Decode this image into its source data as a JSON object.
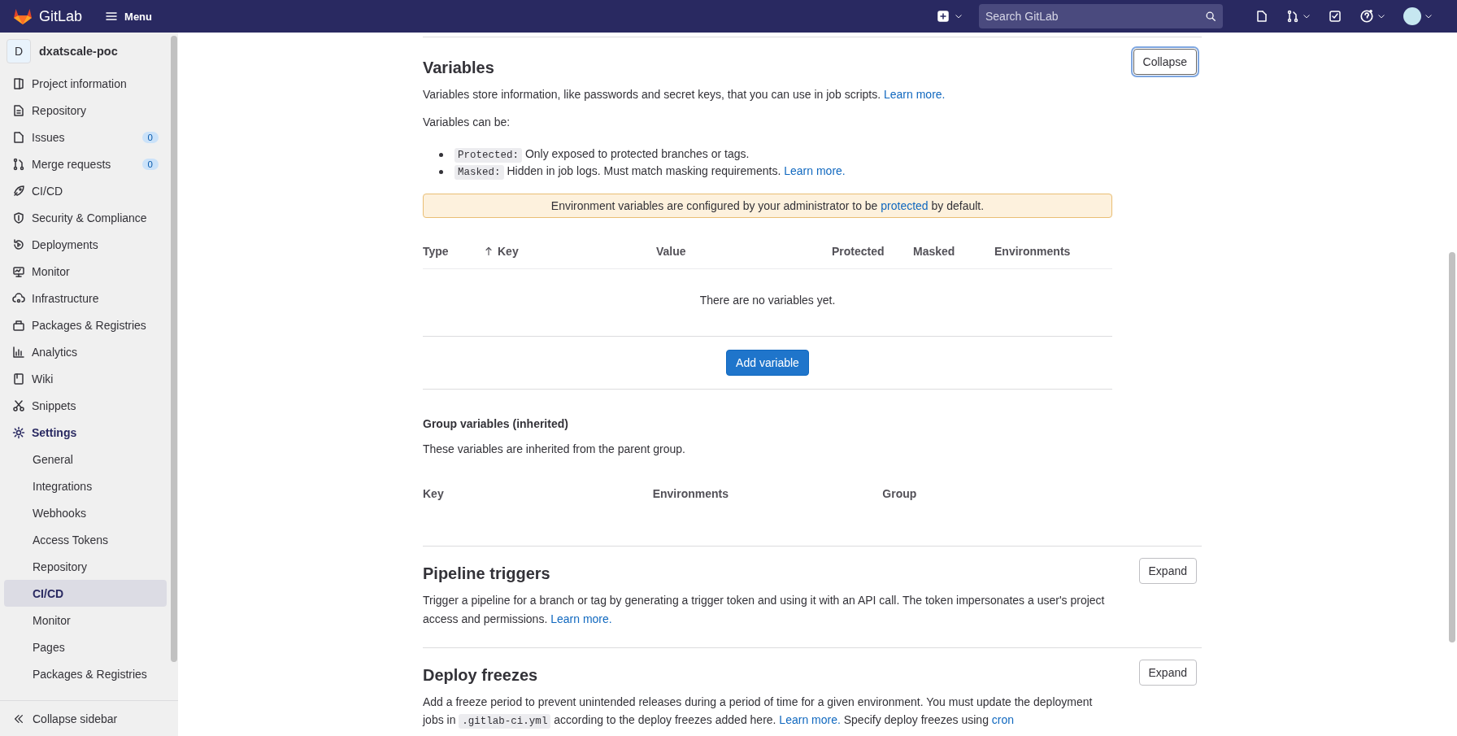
{
  "topbar": {
    "brand": "GitLab",
    "menu": "Menu",
    "search": {
      "placeholder": "Search GitLab"
    }
  },
  "sidebar": {
    "project": {
      "initial": "D",
      "name": "dxatscale-poc"
    },
    "items": [
      {
        "label": "Project information",
        "selected": false
      },
      {
        "label": "Repository",
        "selected": false
      },
      {
        "label": "Issues",
        "badge": "0",
        "selected": false
      },
      {
        "label": "Merge requests",
        "badge": "0",
        "selected": false
      },
      {
        "label": "CI/CD",
        "selected": false
      },
      {
        "label": "Security & Compliance",
        "selected": false
      },
      {
        "label": "Deployments",
        "selected": false
      },
      {
        "label": "Monitor",
        "selected": false
      },
      {
        "label": "Infrastructure",
        "selected": false
      },
      {
        "label": "Packages & Registries",
        "selected": false
      },
      {
        "label": "Analytics",
        "selected": false
      },
      {
        "label": "Wiki",
        "selected": false
      },
      {
        "label": "Snippets",
        "selected": false
      },
      {
        "label": "Settings",
        "selected": true,
        "expanded": true,
        "children": [
          {
            "label": "General",
            "selected": false
          },
          {
            "label": "Integrations",
            "selected": false
          },
          {
            "label": "Webhooks",
            "selected": false
          },
          {
            "label": "Access Tokens",
            "selected": false
          },
          {
            "label": "Repository",
            "selected": false
          },
          {
            "label": "CI/CD",
            "selected": true
          },
          {
            "label": "Monitor",
            "selected": false
          },
          {
            "label": "Pages",
            "selected": false
          },
          {
            "label": "Packages & Registries",
            "selected": false
          }
        ]
      }
    ],
    "collapse": "Collapse sidebar"
  },
  "variables": {
    "title": "Variables",
    "button": {
      "label": "Collapse",
      "focused": true
    },
    "description": [
      {
        "kind": "text",
        "text": "Variables store information, like passwords and secret keys, that you can use in job scripts. "
      },
      {
        "kind": "link",
        "text": "Learn more."
      }
    ],
    "intro": "Variables can be:",
    "options": [
      [
        {
          "kind": "code",
          "text": "Protected:"
        },
        {
          "kind": "text",
          "text": " Only exposed to protected branches or tags."
        }
      ],
      [
        {
          "kind": "code",
          "text": "Masked:"
        },
        {
          "kind": "text",
          "text": " Hidden in job logs. Must match masking requirements. "
        },
        {
          "kind": "link",
          "text": "Learn more."
        }
      ]
    ],
    "alert": [
      {
        "kind": "text",
        "text": "Environment variables are configured by your administrator to be "
      },
      {
        "kind": "link",
        "text": "protected"
      },
      {
        "kind": "text",
        "text": " by default."
      }
    ],
    "table": {
      "columns": [
        {
          "label": "Type",
          "sorted": false
        },
        {
          "label": "Key",
          "sorted": true
        },
        {
          "label": "Value",
          "sorted": false
        },
        {
          "label": "Protected",
          "sorted": false
        },
        {
          "label": "Masked",
          "sorted": false
        },
        {
          "label": "Environments",
          "sorted": false
        }
      ],
      "empty": "There are no variables yet.",
      "add_button": "Add variable"
    },
    "group": {
      "title": "Group variables (inherited)",
      "description": "These variables are inherited from the parent group.",
      "columns": [
        "Key",
        "Environments",
        "Group"
      ]
    }
  },
  "sections": [
    {
      "title": "Pipeline triggers",
      "button": "Expand",
      "description": [
        {
          "kind": "text",
          "text": "Trigger a pipeline for a branch or tag by generating a trigger token and using it with an API call. The token impersonates a user's project access and permissions. "
        },
        {
          "kind": "link",
          "text": "Learn more."
        }
      ]
    },
    {
      "title": "Deploy freezes",
      "button": "Expand",
      "description": [
        {
          "kind": "text",
          "text": "Add a freeze period to prevent unintended releases during a period of time for a given environment. You must update the deployment jobs in "
        },
        {
          "kind": "code",
          "text": ".gitlab-ci.yml"
        },
        {
          "kind": "text",
          "text": " according to the deploy freezes added here. "
        },
        {
          "kind": "link",
          "text": "Learn more."
        },
        {
          "kind": "text",
          "text": " Specify deploy freezes using "
        },
        {
          "kind": "link",
          "text": "cron"
        }
      ]
    }
  ]
}
